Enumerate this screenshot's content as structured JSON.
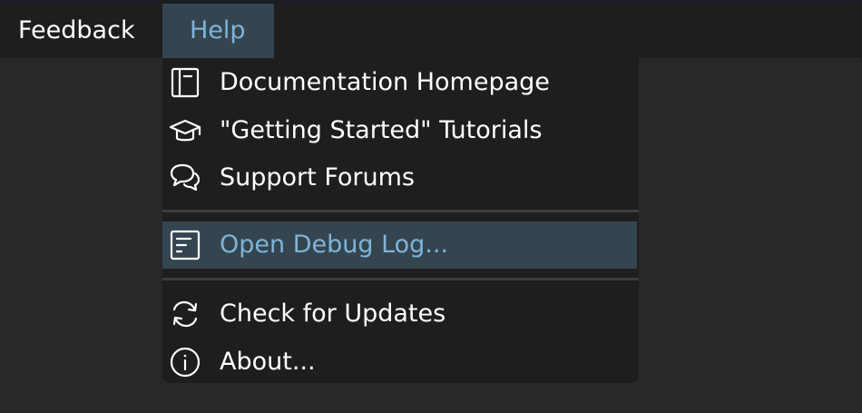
{
  "menubar": {
    "items": [
      {
        "label": "Feedback"
      },
      {
        "label": "Help"
      }
    ]
  },
  "help_menu": {
    "items": [
      {
        "label": "Documentation Homepage",
        "icon": "book-icon"
      },
      {
        "label": "\"Getting Started\" Tutorials",
        "icon": "graduation-cap-icon"
      },
      {
        "label": "Support Forums",
        "icon": "chat-bubbles-icon"
      },
      {
        "label": "Open Debug Log...",
        "icon": "log-file-icon"
      },
      {
        "label": "Check for Updates",
        "icon": "refresh-icon"
      },
      {
        "label": "About...",
        "icon": "info-icon"
      }
    ]
  },
  "colors": {
    "background": "#282828",
    "menu_background": "#1e1e1e",
    "highlight_background": "#344550",
    "highlight_text": "#7fb4d8",
    "text": "#ffffff"
  }
}
